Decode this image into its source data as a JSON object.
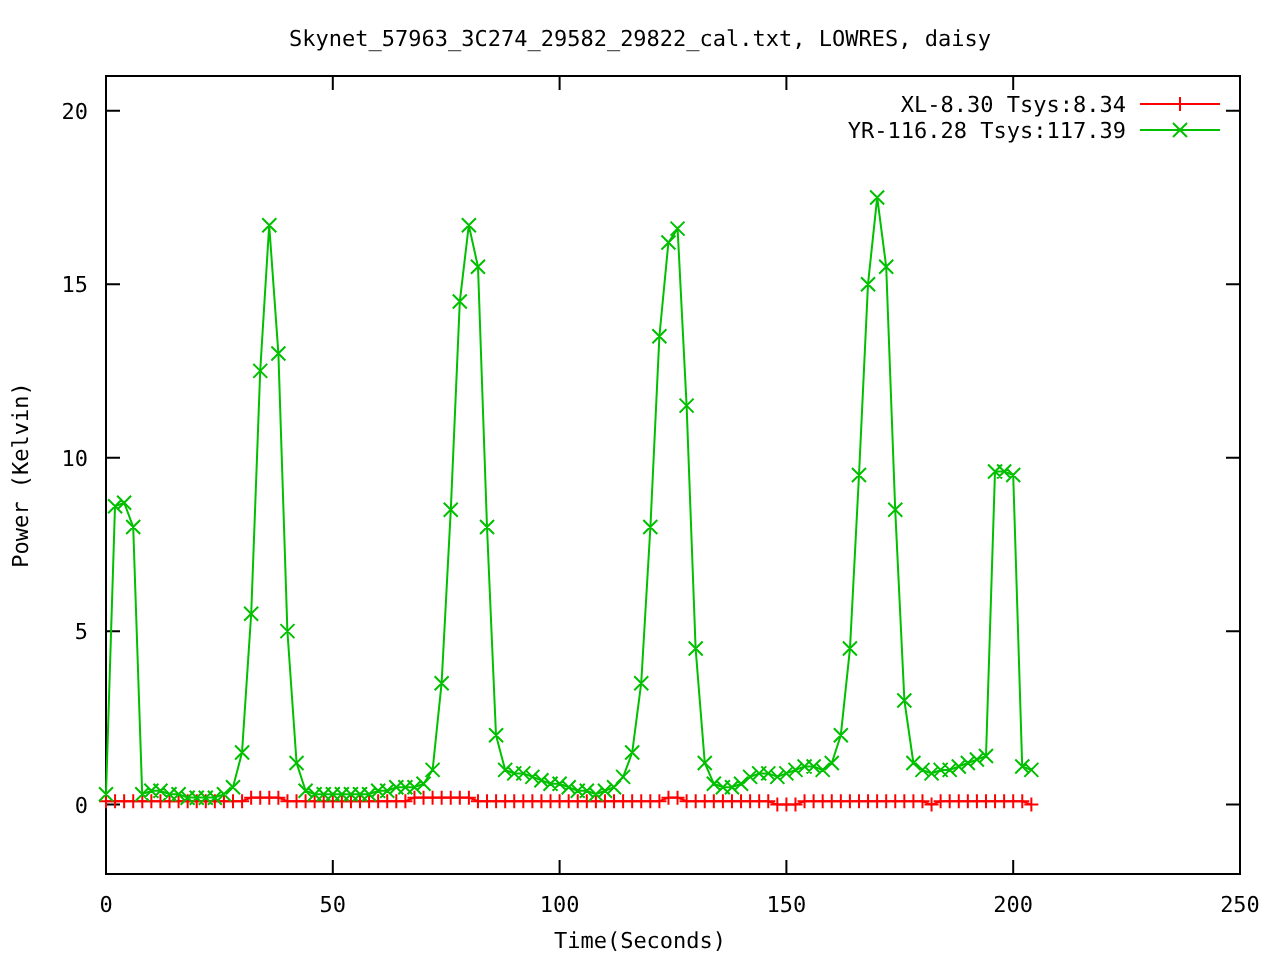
{
  "chart_data": {
    "type": "line",
    "title": "Skynet_57963_3C274_29582_29822_cal.txt, LOWRES, daisy",
    "xlabel": "Time(Seconds)",
    "ylabel": "Power (Kelvin)",
    "x": [
      0,
      2,
      4,
      6,
      8,
      10,
      12,
      14,
      16,
      18,
      20,
      22,
      24,
      26,
      28,
      30,
      32,
      34,
      36,
      38,
      40,
      42,
      44,
      46,
      48,
      50,
      52,
      54,
      56,
      58,
      60,
      62,
      64,
      66,
      68,
      70,
      72,
      74,
      76,
      78,
      80,
      82,
      84,
      86,
      88,
      90,
      92,
      94,
      96,
      98,
      100,
      102,
      104,
      106,
      108,
      110,
      112,
      114,
      116,
      118,
      120,
      122,
      124,
      126,
      128,
      130,
      132,
      134,
      136,
      138,
      140,
      142,
      144,
      146,
      148,
      150,
      152,
      154,
      156,
      158,
      160,
      162,
      164,
      166,
      168,
      170,
      172,
      174,
      176,
      178,
      180,
      182,
      184,
      186,
      188,
      190,
      192,
      194,
      196,
      198,
      200,
      202,
      204
    ],
    "series": [
      {
        "name": "XL-8.30 Tsys:8.34",
        "color": "#ff0000",
        "marker": "plus",
        "values": [
          0.1,
          0.1,
          0.1,
          0.1,
          0.1,
          0.1,
          0.1,
          0.1,
          0.1,
          0.1,
          0.1,
          0.1,
          0.1,
          0.1,
          0.1,
          0.1,
          0.2,
          0.2,
          0.2,
          0.2,
          0.1,
          0.1,
          0.1,
          0.1,
          0.1,
          0.1,
          0.1,
          0.1,
          0.1,
          0.1,
          0.1,
          0.1,
          0.1,
          0.1,
          0.2,
          0.2,
          0.2,
          0.2,
          0.2,
          0.2,
          0.2,
          0.1,
          0.1,
          0.1,
          0.1,
          0.1,
          0.1,
          0.1,
          0.1,
          0.1,
          0.1,
          0.1,
          0.1,
          0.1,
          0.1,
          0.1,
          0.1,
          0.1,
          0.1,
          0.1,
          0.1,
          0.1,
          0.2,
          0.2,
          0.1,
          0.1,
          0.1,
          0.1,
          0.1,
          0.1,
          0.1,
          0.1,
          0.1,
          0.1,
          0.0,
          0.0,
          0.0,
          0.1,
          0.1,
          0.1,
          0.1,
          0.1,
          0.1,
          0.1,
          0.1,
          0.1,
          0.1,
          0.1,
          0.1,
          0.1,
          0.1,
          0.0,
          0.1,
          0.1,
          0.1,
          0.1,
          0.1,
          0.1,
          0.1,
          0.1,
          0.1,
          0.1,
          0.0
        ]
      },
      {
        "name": "YR-116.28 Tsys:117.39",
        "color": "#00c000",
        "marker": "cross",
        "values": [
          0.3,
          8.6,
          8.7,
          8.0,
          0.3,
          0.4,
          0.4,
          0.3,
          0.3,
          0.2,
          0.2,
          0.2,
          0.2,
          0.3,
          0.5,
          1.5,
          5.5,
          12.5,
          16.7,
          13.0,
          5.0,
          1.2,
          0.4,
          0.3,
          0.3,
          0.3,
          0.3,
          0.3,
          0.3,
          0.3,
          0.4,
          0.4,
          0.5,
          0.5,
          0.5,
          0.6,
          1.0,
          3.5,
          8.5,
          14.5,
          16.7,
          15.5,
          8.0,
          2.0,
          1.0,
          0.9,
          0.9,
          0.8,
          0.7,
          0.6,
          0.6,
          0.5,
          0.4,
          0.4,
          0.3,
          0.4,
          0.5,
          0.8,
          1.5,
          3.5,
          8.0,
          13.5,
          16.2,
          16.6,
          11.5,
          4.5,
          1.2,
          0.6,
          0.5,
          0.5,
          0.6,
          0.8,
          0.9,
          0.9,
          0.8,
          0.9,
          1.0,
          1.1,
          1.1,
          1.0,
          1.2,
          2.0,
          4.5,
          9.5,
          15.0,
          17.5,
          15.5,
          8.5,
          3.0,
          1.2,
          1.0,
          0.9,
          1.0,
          1.0,
          1.1,
          1.2,
          1.3,
          1.4,
          9.6,
          9.6,
          9.5,
          1.1,
          1.0
        ]
      }
    ],
    "legend": true,
    "xlim": [
      0,
      250
    ],
    "ylim": [
      -2,
      21
    ],
    "xticks": [
      0,
      50,
      100,
      150,
      200,
      250
    ],
    "yticks": [
      0,
      5,
      10,
      15,
      20
    ]
  }
}
